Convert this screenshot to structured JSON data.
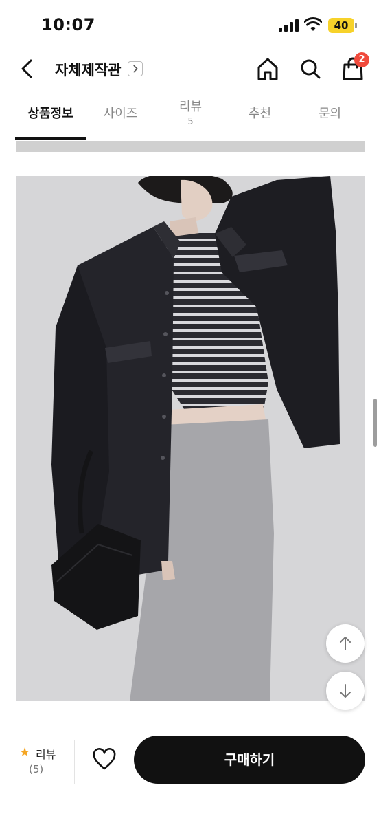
{
  "status_bar": {
    "time": "10:07",
    "battery": "40"
  },
  "header": {
    "shop_name": "자체제작관",
    "cart_count": "2"
  },
  "tabs": [
    {
      "label": "상품정보",
      "active": true
    },
    {
      "label": "사이즈"
    },
    {
      "label": "리뷰",
      "count": "5"
    },
    {
      "label": "추천"
    },
    {
      "label": "문의"
    }
  ],
  "bottom_bar": {
    "review_label": "리뷰",
    "review_count": "(5)",
    "buy_label": "구매하기"
  },
  "icons": {
    "back": "chevron-left-icon",
    "home": "home-icon",
    "search": "search-icon",
    "cart": "shopping-bag-icon",
    "scroll_up": "arrow-up-icon",
    "scroll_down": "arrow-down-icon",
    "wishlist": "heart-icon",
    "rating": "star-icon"
  },
  "colors": {
    "accent": "#111111",
    "badge": "#f04a3c",
    "star": "#f5a623",
    "battery": "#f7d22a"
  }
}
